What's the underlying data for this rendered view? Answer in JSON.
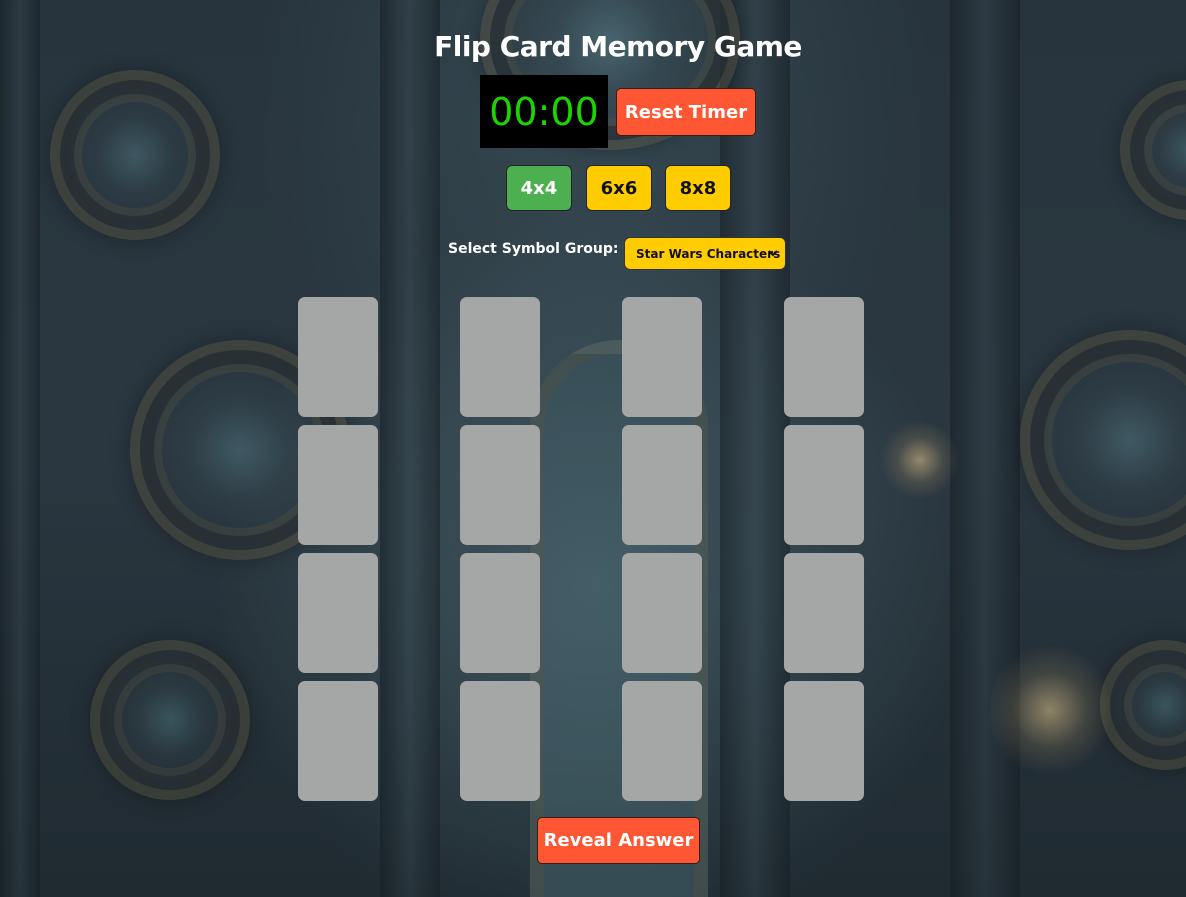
{
  "page": {
    "title": "Flip Card Memory Game"
  },
  "timer": {
    "display": "00:00",
    "color": "#1bd400"
  },
  "controls": {
    "reset_label": "Reset Timer",
    "reveal_label": "Reveal Answer",
    "grid_sizes": [
      {
        "label": "4x4",
        "active": true
      },
      {
        "label": "6x6",
        "active": false
      },
      {
        "label": "8x8",
        "active": false
      }
    ]
  },
  "symbol_group": {
    "label": "Select Symbol Group:",
    "selected": "Star Wars Characters"
  },
  "board": {
    "rows": 4,
    "cols": 4,
    "card_state": "face-down"
  },
  "colors": {
    "accent_orange": "#ff5733",
    "active_green": "#4caf50",
    "inactive_yellow": "#ffcc00",
    "card_back": "#a5a7a6"
  }
}
